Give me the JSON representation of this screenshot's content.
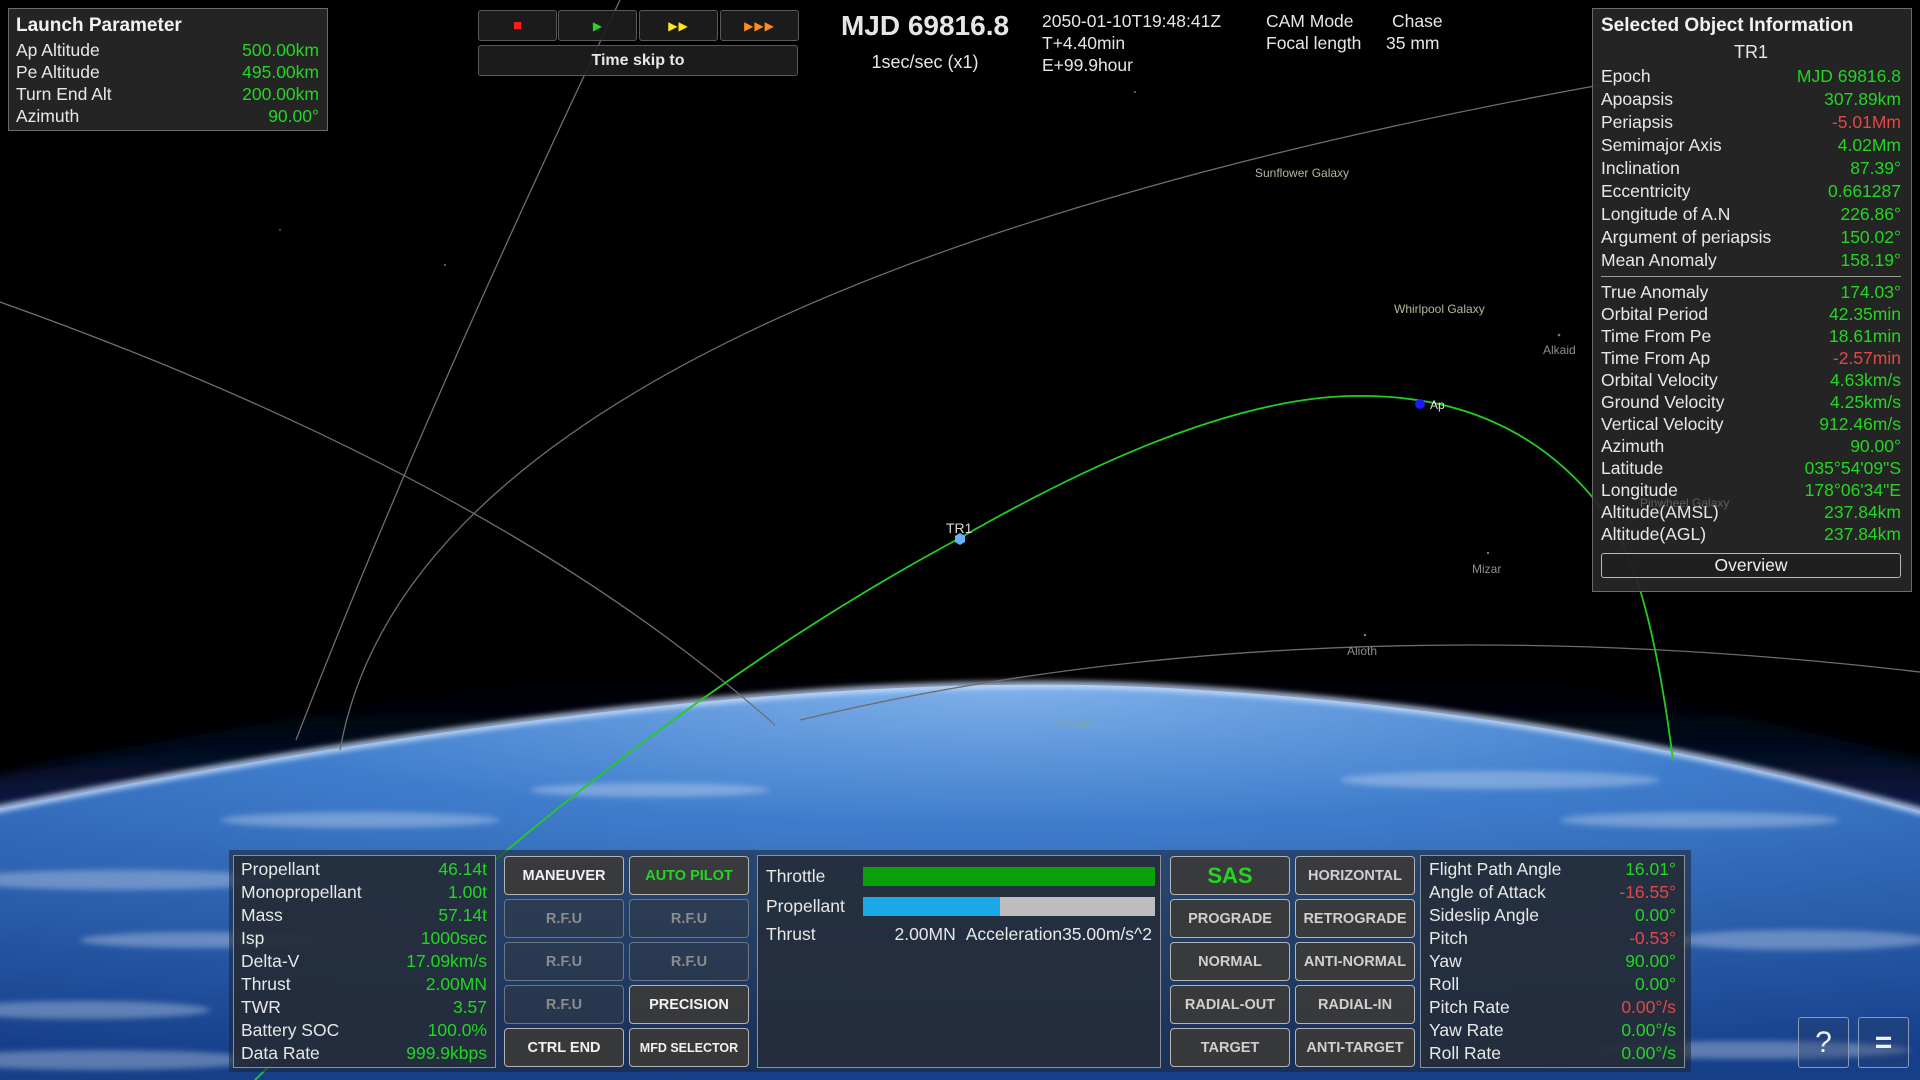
{
  "launch_parameter": {
    "title": "Launch Parameter",
    "rows": [
      {
        "label": "Ap Altitude",
        "value": "500.00km"
      },
      {
        "label": "Pe Altitude",
        "value": "495.00km"
      },
      {
        "label": "Turn End Alt",
        "value": "200.00km"
      },
      {
        "label": "Azimuth",
        "value": "90.00°"
      }
    ]
  },
  "time_controls": {
    "buttons": [
      {
        "name": "stop",
        "icon": "stop-icon",
        "glyph": "■",
        "color": "#ff1a1a"
      },
      {
        "name": "play",
        "icon": "play-icon",
        "glyph": "▶",
        "color": "#22d622"
      },
      {
        "name": "fast-forward",
        "icon": "fast-forward-icon",
        "glyph": "▶▶",
        "color": "#ffe81a"
      },
      {
        "name": "faster-forward",
        "icon": "triple-forward-icon",
        "glyph": "▶▶▶",
        "color": "#ff8c1a"
      }
    ],
    "skip_label": "Time skip to"
  },
  "clock": {
    "mjd": "MJD 69816.8",
    "rate": "1sec/sec (x1)",
    "utc": "2050-01-10T19:48:41Z",
    "mission_time": "T+4.40min",
    "elapsed": "E+99.9hour"
  },
  "camera": {
    "mode_label": "CAM Mode",
    "mode_value": "Chase",
    "focal_label": "Focal length",
    "focal_value": "35 mm"
  },
  "selected_object": {
    "title": "Selected Object Information",
    "object_name": "TR1",
    "orbital_elements": [
      {
        "label": "Epoch",
        "value": "MJD 69816.8",
        "negative": false
      },
      {
        "label": "Apoapsis",
        "value": "307.89km",
        "negative": false
      },
      {
        "label": "Periapsis",
        "value": "-5.01Mm",
        "negative": true
      },
      {
        "label": "Semimajor Axis",
        "value": "4.02Mm",
        "negative": false
      },
      {
        "label": "Inclination",
        "value": "87.39°",
        "negative": false
      },
      {
        "label": "Eccentricity",
        "value": "0.661287",
        "negative": false
      },
      {
        "label": "Longitude of A.N",
        "value": "226.86°",
        "negative": false
      },
      {
        "label": "Argument of periapsis",
        "value": "150.02°",
        "negative": false
      },
      {
        "label": "Mean Anomaly",
        "value": "158.19°",
        "negative": false
      }
    ],
    "state": [
      {
        "label": "True Anomaly",
        "value": "174.03°",
        "negative": false
      },
      {
        "label": "Orbital Period",
        "value": "42.35min",
        "negative": false
      },
      {
        "label": "Time From Pe",
        "value": "18.61min",
        "negative": false
      },
      {
        "label": "Time From Ap",
        "value": "-2.57min",
        "negative": true
      },
      {
        "label": "Orbital Velocity",
        "value": "4.63km/s",
        "negative": false
      },
      {
        "label": "Ground Velocity",
        "value": "4.25km/s",
        "negative": false
      },
      {
        "label": "Vertical Velocity",
        "value": "912.46m/s",
        "negative": false
      },
      {
        "label": "Azimuth",
        "value": "90.00°",
        "negative": false
      },
      {
        "label": "Latitude",
        "value": "035°54'09\"S",
        "negative": false
      },
      {
        "label": "Longitude",
        "value": "178°06'34\"E",
        "negative": false
      },
      {
        "label": "Altitude(AMSL)",
        "value": "237.84km",
        "negative": false
      },
      {
        "label": "Altitude(AGL)",
        "value": "237.84km",
        "negative": false
      }
    ],
    "overview_label": "Overview"
  },
  "vessel_status": {
    "rows": [
      {
        "label": "Propellant",
        "value": "46.14t"
      },
      {
        "label": "Monopropellant",
        "value": "1.00t"
      },
      {
        "label": "Mass",
        "value": "57.14t"
      },
      {
        "label": "Isp",
        "value": "1000sec"
      },
      {
        "label": "Delta-V",
        "value": "17.09km/s"
      },
      {
        "label": "Thrust",
        "value": "2.00MN"
      },
      {
        "label": "TWR",
        "value": "3.57"
      },
      {
        "label": "Battery SOC",
        "value": "100.0%"
      },
      {
        "label": "Data Rate",
        "value": "999.9kbps"
      }
    ]
  },
  "control_buttons": [
    {
      "label": "MANEUVER",
      "style": "normal"
    },
    {
      "label": "AUTO PILOT",
      "style": "green"
    },
    {
      "label": "R.F.U",
      "style": "dim"
    },
    {
      "label": "R.F.U",
      "style": "dim"
    },
    {
      "label": "R.F.U",
      "style": "dim"
    },
    {
      "label": "R.F.U",
      "style": "dim"
    },
    {
      "label": "R.F.U",
      "style": "dim"
    },
    {
      "label": "PRECISION",
      "style": "normal"
    },
    {
      "label": "CTRL END",
      "style": "normal"
    },
    {
      "label": "MFD SELECTOR",
      "style": "small"
    }
  ],
  "engine": {
    "throttle_label": "Throttle",
    "throttle_fraction": 1.0,
    "throttle_color": "#0aa00a",
    "propellant_label": "Propellant",
    "propellant_fraction": 0.47,
    "propellant_color": "#1aa8e6",
    "thrust_label": "Thrust",
    "thrust_value": "2.00MN",
    "acceleration_label": "Acceleration",
    "acceleration_value": "35.00m/s^2"
  },
  "sas_buttons": [
    {
      "label": "SAS",
      "style": "big"
    },
    {
      "label": "HORIZONTAL",
      "style": "gray"
    },
    {
      "label": "PROGRADE",
      "style": "gray"
    },
    {
      "label": "RETROGRADE",
      "style": "gray"
    },
    {
      "label": "NORMAL",
      "style": "gray"
    },
    {
      "label": "ANTI-NORMAL",
      "style": "gray"
    },
    {
      "label": "RADIAL-OUT",
      "style": "gray"
    },
    {
      "label": "RADIAL-IN",
      "style": "gray"
    },
    {
      "label": "TARGET",
      "style": "gray"
    },
    {
      "label": "ANTI-TARGET",
      "style": "gray"
    }
  ],
  "attitude": {
    "rows": [
      {
        "label": "Flight Path Angle",
        "value": "16.01°",
        "negative": false
      },
      {
        "label": "Angle of Attack",
        "value": "-16.55°",
        "negative": true
      },
      {
        "label": "Sideslip Angle",
        "value": "0.00°",
        "negative": false
      },
      {
        "label": "Pitch",
        "value": "-0.53°",
        "negative": true
      },
      {
        "label": "Yaw",
        "value": "90.00°",
        "negative": false
      },
      {
        "label": "Roll",
        "value": "0.00°",
        "negative": false
      },
      {
        "label": "Pitch Rate",
        "value": "0.00°/s",
        "negative": true
      },
      {
        "label": "Yaw Rate",
        "value": "0.00°/s",
        "negative": false
      },
      {
        "label": "Roll Rate",
        "value": "0.00°/s",
        "negative": false
      }
    ]
  },
  "corner_buttons": {
    "help_glyph": "?",
    "menu_glyph": "="
  },
  "scene": {
    "vessel_label": "TR1",
    "apoapsis_label": "Ap",
    "orbit_color": "#22cc22",
    "sky_labels": [
      {
        "text": "Sunflower Galaxy",
        "kind": "galaxy"
      },
      {
        "text": "Whirlpool Galaxy",
        "kind": "galaxy"
      },
      {
        "text": "Alkaid",
        "kind": "star"
      },
      {
        "text": "Mizar",
        "kind": "star"
      },
      {
        "text": "Alioth",
        "kind": "star"
      },
      {
        "text": "Pinwheel Galaxy",
        "kind": "galaxy-faint"
      },
      {
        "text": "Phecda",
        "kind": "star-faint"
      }
    ]
  }
}
